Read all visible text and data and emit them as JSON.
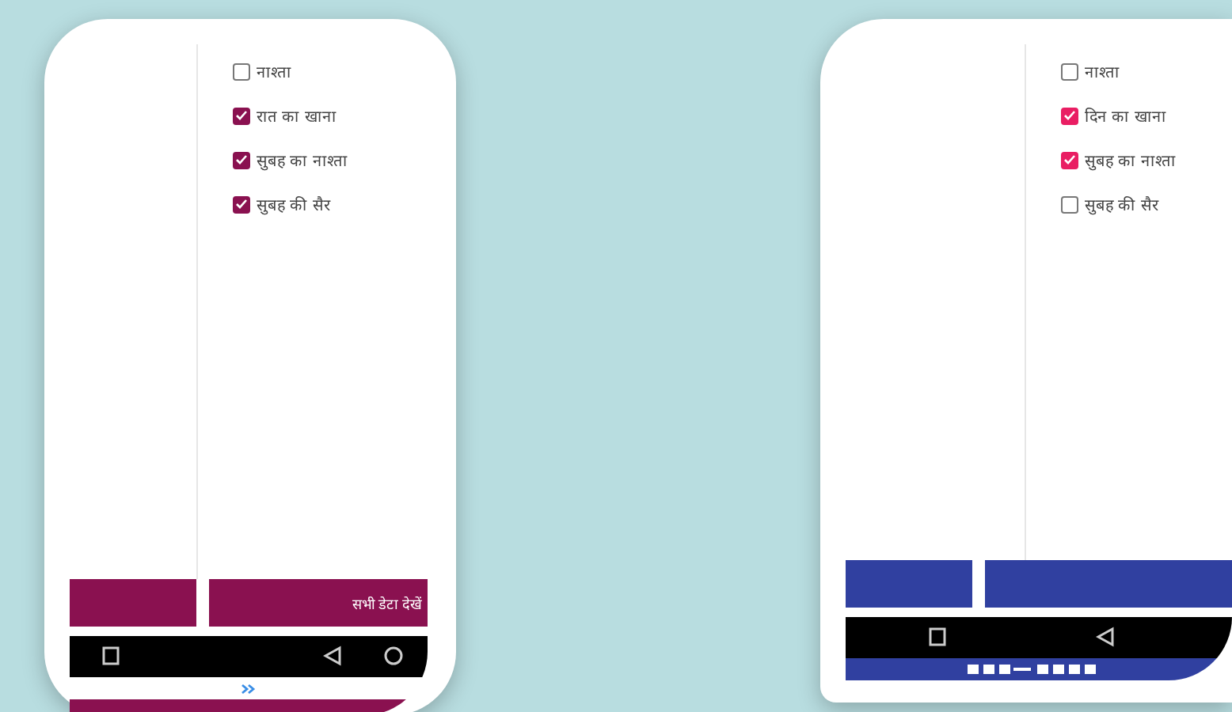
{
  "phones": [
    {
      "color": "#8a1150",
      "bar": {
        "color": "#8a1150"
      },
      "items": [
        {
          "label": "नाश्ता",
          "checked": false
        },
        {
          "label": "रात का खाना",
          "checked": true
        },
        {
          "label": "सुबह का नाश्ता",
          "checked": true
        },
        {
          "label": "सुबह की सैर",
          "checked": true
        }
      ],
      "bar_label": "सभी डेटा देखें",
      "nav": [
        {
          "kind": "square"
        },
        {
          "kind": "back"
        },
        {
          "kind": "circle"
        }
      ]
    },
    {
      "color": "#e91e63",
      "bar": {
        "color": "#3040a0"
      },
      "items": [
        {
          "label": "नाश्ता",
          "checked": false
        },
        {
          "label": "दिन का खाना",
          "checked": true
        },
        {
          "label": "सुबह का नाश्ता",
          "checked": true
        },
        {
          "label": "सुबह की सैर",
          "checked": false
        }
      ],
      "nav": [
        {
          "kind": "square"
        },
        {
          "kind": "back"
        }
      ]
    }
  ]
}
